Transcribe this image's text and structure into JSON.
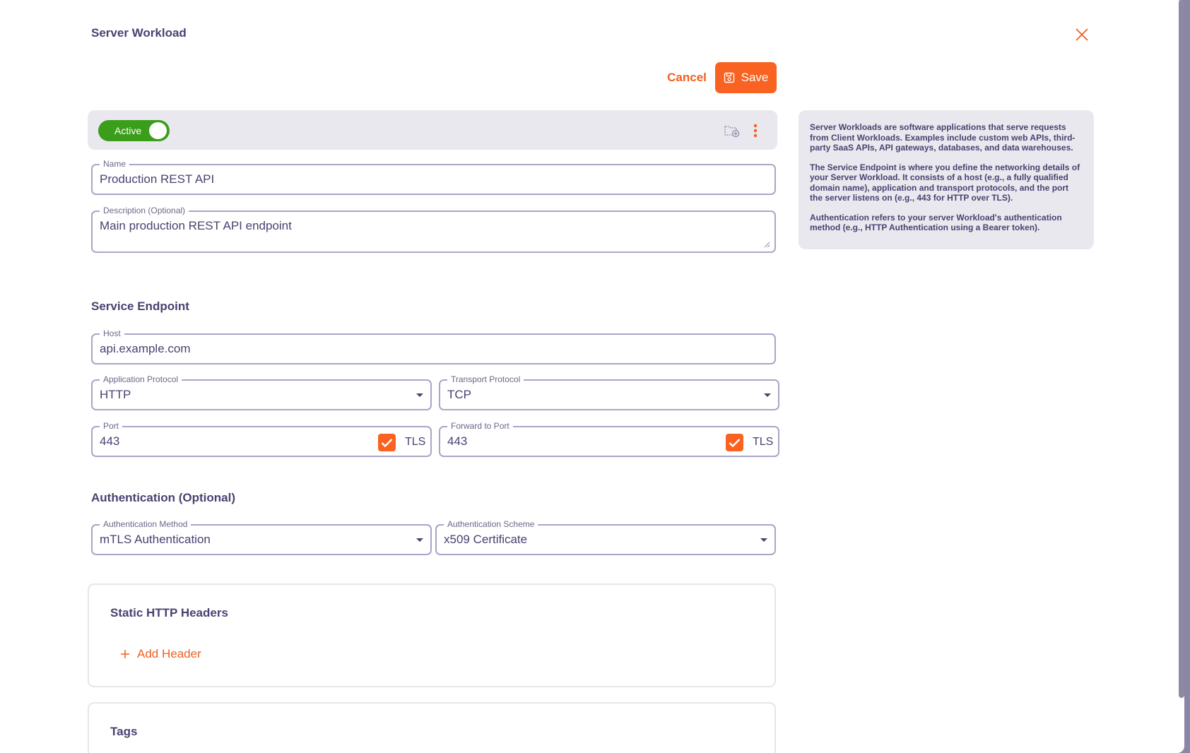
{
  "header": {
    "title": "Server Workload"
  },
  "actions": {
    "cancel_label": "Cancel",
    "save_label": "Save"
  },
  "status": {
    "toggle_label": "Active",
    "active": true
  },
  "fields": {
    "name": {
      "label": "Name",
      "value": "Production REST API"
    },
    "description": {
      "label": "Description (Optional)",
      "value": "Main production REST API endpoint"
    }
  },
  "service_endpoint": {
    "title": "Service Endpoint",
    "host": {
      "label": "Host",
      "value": "api.example.com"
    },
    "app_protocol": {
      "label": "Application Protocol",
      "value": "HTTP"
    },
    "transport_protocol": {
      "label": "Transport Protocol",
      "value": "TCP"
    },
    "port": {
      "label": "Port",
      "value": "443",
      "tls_label": "TLS",
      "tls_checked": true
    },
    "forward_port": {
      "label": "Forward to Port",
      "value": "443",
      "tls_label": "TLS",
      "tls_checked": true
    }
  },
  "authentication": {
    "title": "Authentication (Optional)",
    "method": {
      "label": "Authentication Method",
      "value": "mTLS Authentication"
    },
    "scheme": {
      "label": "Authentication Scheme",
      "value": "x509 Certificate"
    }
  },
  "static_headers": {
    "title": "Static HTTP Headers",
    "add_label": "Add Header"
  },
  "tags": {
    "title": "Tags"
  },
  "info": {
    "p1": "Server Workloads are software applications that serve requests from Client Workloads. Examples include custom web APIs, third-party SaaS APIs, API gateways, databases, and data warehouses.",
    "p2": "The Service Endpoint is where you define the networking details of your Server Workload. It consists of a host (e.g., a fully qualified domain name), application and transport protocols, and the port the server listens on (e.g., 443 for HTTP over TLS).",
    "p3": "Authentication refers to your server Workload's authentication method (e.g., HTTP Authentication using a Bearer token)."
  },
  "colors": {
    "accent": "#f96221",
    "active": "#3b9e1a",
    "text": "#4a4170",
    "border": "#a9a6c7"
  }
}
